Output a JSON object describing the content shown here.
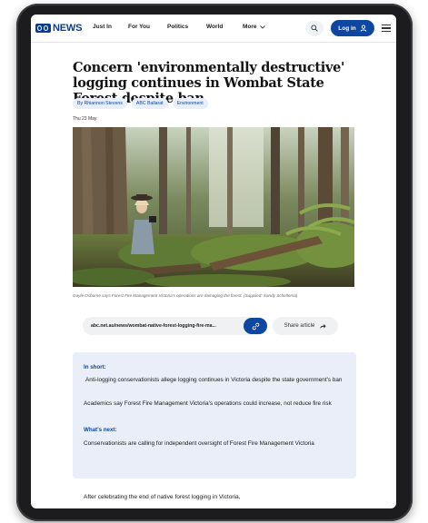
{
  "nav": {
    "logo_text": "NEWS",
    "items": [
      "Just In",
      "For You",
      "Politics",
      "World",
      "More"
    ],
    "login_label": "Log in"
  },
  "article": {
    "headline": "Concern 'environmentally destructive' logging continues in Wombat State Forest despite ban",
    "tags": [
      "By Rhiannon Stevens",
      "ABC Ballarat",
      "Environment"
    ],
    "date": "Thu 23 May",
    "caption": "Gayle Osborne says Forest Fire Management Victoria's operations are damaging the forest. (Supplied: Sandy Scheltema)",
    "url": "abc.net.au/news/wombat-native-forest-logging-fire-ma...",
    "share_label": "Share article",
    "body_start": "After celebrating the end of native forest logging in Victoria,"
  },
  "in_short": {
    "heading": "In short:",
    "points": [
      "Anti-logging conservationists allege logging continues in Victoria despite the state government's ban",
      "Academics say Forest Fire Management Victoria's operations could increase, not reduce fire risk"
    ],
    "next_heading": "What's next:",
    "next_text": "Conservationists are calling for independent oversight of Forest Fire Management Victoria"
  },
  "colors": {
    "brand_blue": "#0d47a1",
    "summary_bg": "#e9eef8",
    "tag_bg": "#e8eefa"
  },
  "icons": [
    "search-icon",
    "user-icon",
    "menu-icon",
    "link-icon",
    "share-arrow-icon",
    "chevron-down-icon"
  ]
}
